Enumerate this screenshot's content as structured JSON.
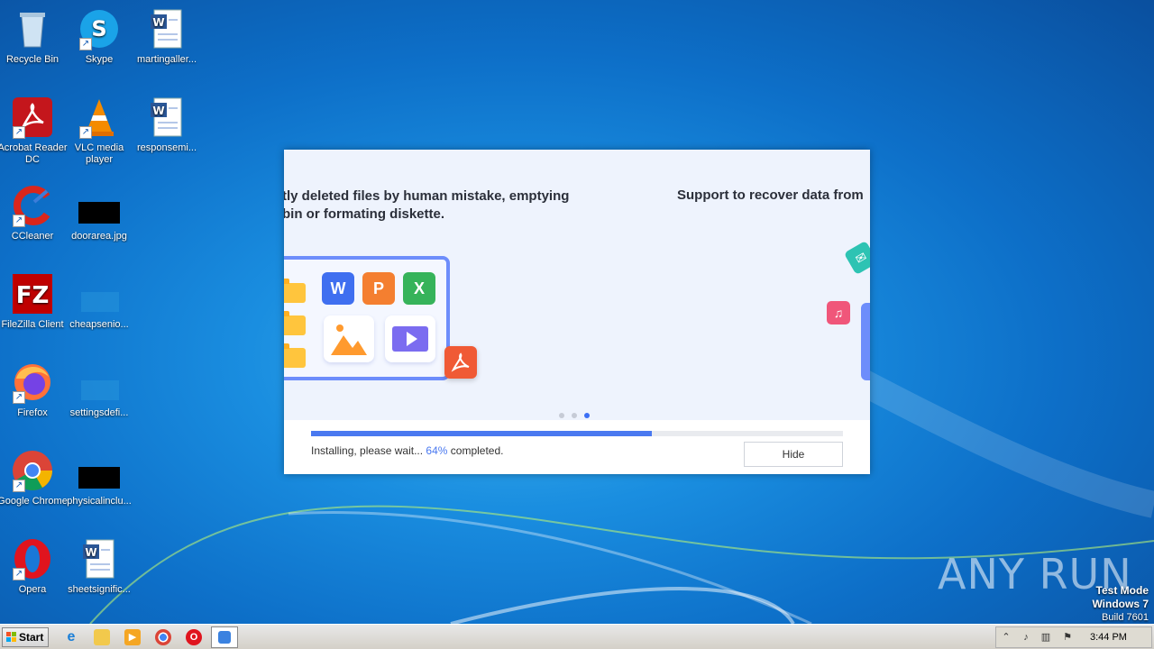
{
  "desktop": {
    "icons": [
      {
        "label": "Recycle Bin"
      },
      {
        "label": "Skype"
      },
      {
        "label": "martingaller..."
      },
      {
        "label": "Acrobat Reader DC"
      },
      {
        "label": "VLC media player"
      },
      {
        "label": "responsemi..."
      },
      {
        "label": "CCleaner"
      },
      {
        "label": "doorarea.jpg"
      },
      {
        "label": "FileZilla Client"
      },
      {
        "label": "cheapsenio..."
      },
      {
        "label": "Firefox"
      },
      {
        "label": "settingsdefi..."
      },
      {
        "label": "Google Chrome"
      },
      {
        "label": "physicalinclu..."
      },
      {
        "label": "Opera"
      },
      {
        "label": "sheetsignific..."
      }
    ]
  },
  "installer": {
    "slide_text_1": "tly deleted files by human mistake, emptying\nbin or formating diskette.",
    "slide_text_2": "Support to recover data from",
    "tiles": {
      "word": "W",
      "powerpoint": "P",
      "excel": "X"
    },
    "slide_count": 3,
    "active_slide": 3,
    "progress_percent": 64,
    "status_prefix": "Installing, please wait... ",
    "status_percent": "64%",
    "status_suffix": " completed.",
    "hide_label": "Hide"
  },
  "watermark": {
    "text": "ANY RUN"
  },
  "testmode": {
    "line1": "Test Mode",
    "line2": "Windows 7",
    "line3": "Build 7601"
  },
  "taskbar": {
    "start_label": "Start",
    "clock": "3:44 PM"
  }
}
